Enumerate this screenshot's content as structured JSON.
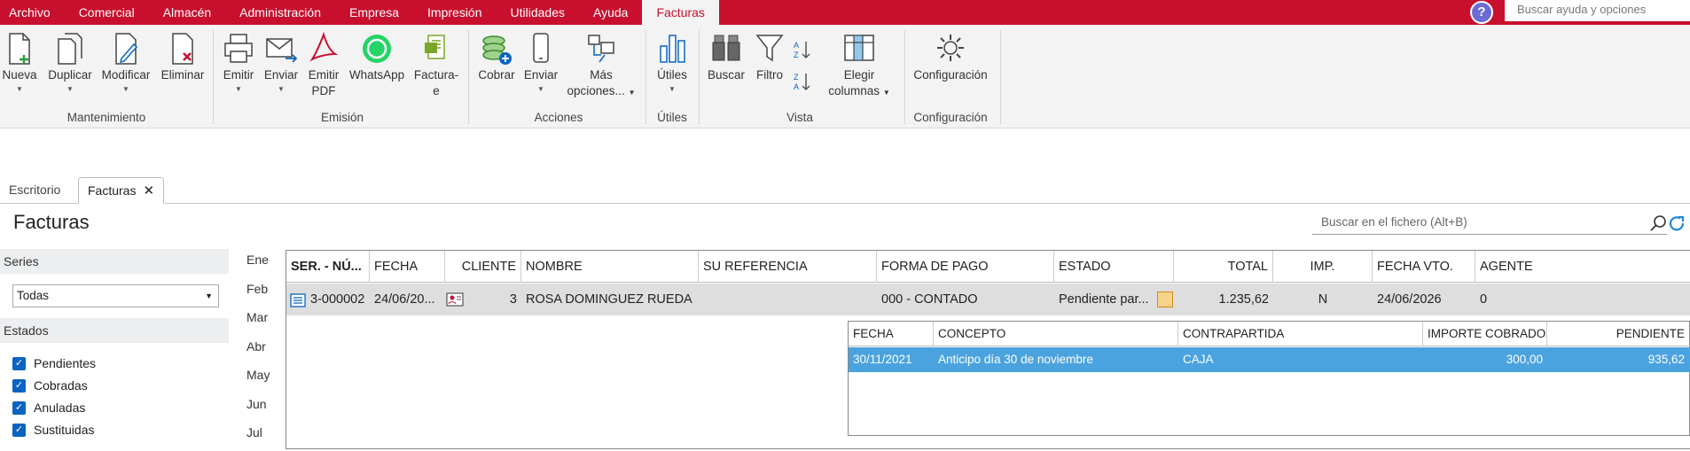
{
  "menubar": {
    "items": [
      "Archivo",
      "Comercial",
      "Almacén",
      "Administración",
      "Empresa",
      "Impresión",
      "Utilidades",
      "Ayuda",
      "Facturas"
    ],
    "help_search_placeholder": "Buscar ayuda y opciones"
  },
  "ribbon": {
    "buttons": {
      "nueva": "Nueva",
      "duplicar": "Duplicar",
      "modificar": "Modificar",
      "eliminar": "Eliminar",
      "emitir": "Emitir",
      "enviar": "Enviar",
      "emitir_pdf_1": "Emitir",
      "emitir_pdf_2": "PDF",
      "whatsapp": "WhatsApp",
      "facturae_1": "Factura-",
      "facturae_2": "e",
      "cobrar": "Cobrar",
      "enviar2": "Enviar",
      "mas_1": "Más",
      "mas_2": "opciones...",
      "utiles": "Útiles",
      "buscar": "Buscar",
      "filtro": "Filtro",
      "elegir_1": "Elegir",
      "elegir_2": "columnas",
      "configuracion": "Configuración"
    },
    "groups": {
      "mantenimiento": "Mantenimiento",
      "emision": "Emisión",
      "acciones": "Acciones",
      "utiles": "Útiles",
      "vista": "Vista",
      "configuracion": "Configuración"
    }
  },
  "tabs": {
    "escritorio": "Escritorio",
    "facturas": "Facturas"
  },
  "page": {
    "title": "Facturas",
    "search_placeholder": "Buscar en el fichero (Alt+B)"
  },
  "sidebar": {
    "series_header": "Series",
    "series_value": "Todas",
    "estados_header": "Estados",
    "estados": [
      "Pendientes",
      "Cobradas",
      "Anuladas",
      "Sustituidas"
    ]
  },
  "months": [
    "Ene",
    "Feb",
    "Mar",
    "Abr",
    "May",
    "Jun",
    "Jul"
  ],
  "grid": {
    "headers": {
      "ser": "SER. - NÚ...",
      "fecha": "FECHA",
      "cliente": "CLIENTE",
      "nombre": "NOMBRE",
      "referencia": "SU REFERENCIA",
      "forma_pago": "FORMA DE PAGO",
      "estado": "ESTADO",
      "total": "TOTAL",
      "imp": "IMP.",
      "fecha_vto": "FECHA VTO.",
      "agente": "AGENTE"
    },
    "row": {
      "ser": "3-000002",
      "fecha": "24/06/20...",
      "cliente": "3",
      "nombre": "ROSA DOMINGUEZ RUEDA",
      "referencia": "",
      "forma_pago": "000 - CONTADO",
      "estado": "Pendiente par...",
      "total": "1.235,62",
      "imp": "N",
      "fecha_vto": "24/06/2026",
      "agente": "0"
    }
  },
  "subgrid": {
    "headers": {
      "fecha": "FECHA",
      "concepto": "CONCEPTO",
      "contrapartida": "CONTRAPARTIDA",
      "importe": "IMPORTE COBRADO",
      "pendiente": "PENDIENTE"
    },
    "row": {
      "fecha": "30/11/2021",
      "concepto": "Anticipo día 30 de noviembre",
      "contrapartida": "CAJA",
      "importe": "300,00",
      "pendiente": "935,62"
    }
  },
  "colors": {
    "brand": "#c8102e",
    "selected_row": "#4aa3df",
    "checkbox": "#0a64c0"
  }
}
